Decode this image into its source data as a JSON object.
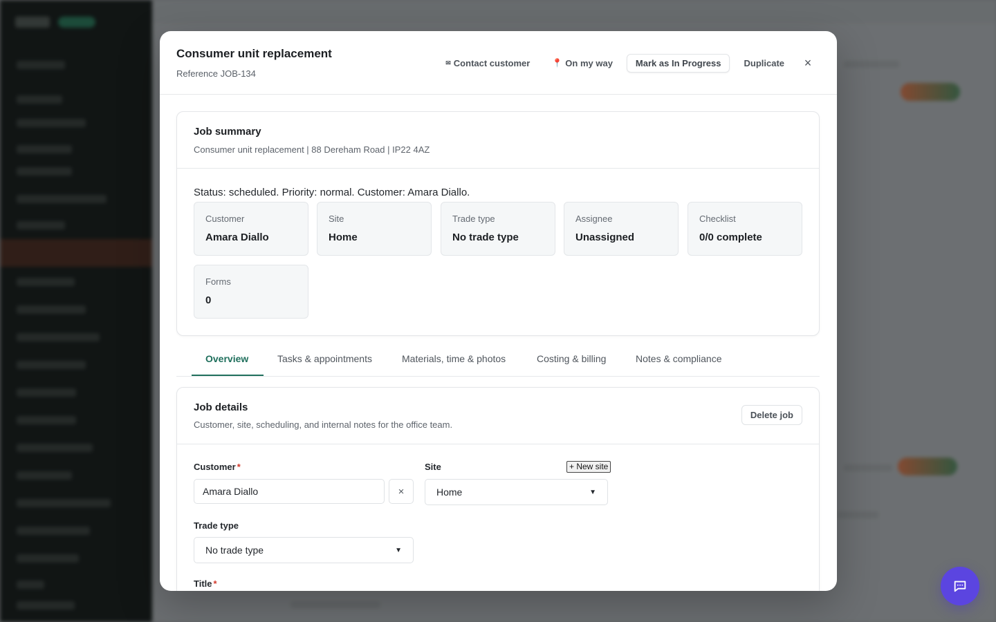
{
  "modal": {
    "title": "Consumer unit replacement",
    "reference": "Reference JOB-134",
    "actions": {
      "contact_icon": "✉",
      "contact": "Contact customer",
      "on_my_way_icon": "📍",
      "on_my_way": "On my way",
      "mark_in_progress": "Mark as In Progress",
      "duplicate": "Duplicate",
      "close": "×"
    }
  },
  "summary": {
    "title": "Job summary",
    "subtitle": "Consumer unit replacement | 88 Dereham Road | IP22 4AZ",
    "status_line": "Status: scheduled. Priority: normal. Customer: Amara Diallo.",
    "stats": [
      {
        "label": "Customer",
        "value": "Amara Diallo"
      },
      {
        "label": "Site",
        "value": "Home"
      },
      {
        "label": "Trade type",
        "value": "No trade type"
      },
      {
        "label": "Assignee",
        "value": "Unassigned"
      },
      {
        "label": "Checklist",
        "value": "0/0 complete"
      },
      {
        "label": "Forms",
        "value": "0"
      }
    ]
  },
  "tabs": [
    {
      "label": "Overview",
      "active": true
    },
    {
      "label": "Tasks & appointments",
      "active": false
    },
    {
      "label": "Materials, time & photos",
      "active": false
    },
    {
      "label": "Costing & billing",
      "active": false
    },
    {
      "label": "Notes & compliance",
      "active": false
    }
  ],
  "details": {
    "title": "Job details",
    "subtitle": "Customer, site, scheduling, and internal notes for the office team.",
    "delete_label": "Delete job",
    "customer_label": "Customer",
    "customer_value": "Amara Diallo",
    "clear_icon": "×",
    "site_label": "Site",
    "new_site_label": "+ New site",
    "site_value": "Home",
    "trade_type_label": "Trade type",
    "trade_type_value": "No trade type",
    "title_label": "Title",
    "required_mark": "*"
  },
  "colors": {
    "accent": "#1f6f5c",
    "required": "#d33a2c",
    "chat_fab": "#5b45e0"
  }
}
